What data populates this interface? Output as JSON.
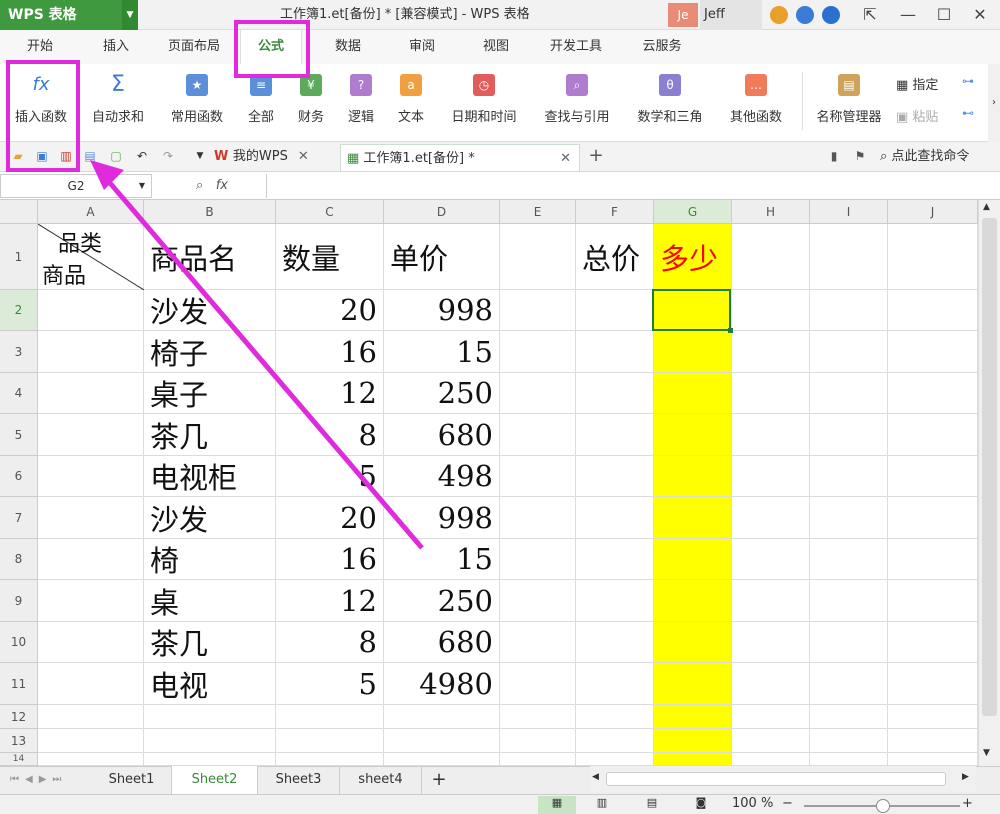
{
  "titlebar": {
    "app": "WPS 表格",
    "document": "工作簿1.et[备份] * [兼容模式] - WPS 表格",
    "avatar": "Je",
    "user": "Jeff"
  },
  "tabs": [
    "开始",
    "插入",
    "页面布局",
    "公式",
    "数据",
    "审阅",
    "视图",
    "开发工具",
    "云服务"
  ],
  "ribbon": {
    "insert_function": "插入函数",
    "autosum": "自动求和",
    "common": "常用函数",
    "all": "全部",
    "finance": "财务",
    "logic": "逻辑",
    "text": "文本",
    "datetime": "日期和时间",
    "lookup": "查找与引用",
    "math": "数学和三角",
    "other": "其他函数",
    "name_manager": "名称管理器",
    "specify": "指定",
    "paste": "粘贴"
  },
  "docs": {
    "my_wps": "我的WPS",
    "workbook": "工作簿1.et[备份] *",
    "find": "点此查找命令"
  },
  "formula": {
    "namebox": "G2",
    "fx": "fx"
  },
  "columns": [
    "A",
    "B",
    "C",
    "D",
    "E",
    "F",
    "G",
    "H",
    "I",
    "J"
  ],
  "rows": [
    "1",
    "2",
    "3",
    "4",
    "5",
    "6",
    "7",
    "8",
    "9",
    "10",
    "11",
    "12",
    "13",
    "14"
  ],
  "header": {
    "diag_top": "品类",
    "diag_bottom": "商品",
    "b": "商品名",
    "c": "数量",
    "d": "单价",
    "f": "总价",
    "g": "多少"
  },
  "table": [
    {
      "name": "沙发",
      "qty": "20",
      "price": "998"
    },
    {
      "name": "椅子",
      "qty": "16",
      "price": "15"
    },
    {
      "name": "桌子",
      "qty": "12",
      "price": "250"
    },
    {
      "name": "茶几",
      "qty": "8",
      "price": "680"
    },
    {
      "name": "电视柜",
      "qty": "5",
      "price": "498"
    },
    {
      "name": "沙发",
      "qty": "20",
      "price": "998"
    },
    {
      "name": "椅",
      "qty": "16",
      "price": "15"
    },
    {
      "name": "桌",
      "qty": "12",
      "price": "250"
    },
    {
      "name": "茶几",
      "qty": "8",
      "price": "680"
    },
    {
      "name": "电视",
      "qty": "5",
      "price": "4980"
    }
  ],
  "sheets": [
    "Sheet1",
    "Sheet2",
    "Sheet3",
    "sheet4"
  ],
  "status": {
    "zoom": "100 %"
  },
  "colors": {
    "accent": "#3a8a3a",
    "highlight": "#e02bdc",
    "cell_fill": "#ffff00",
    "header_text": "#ff0000"
  }
}
